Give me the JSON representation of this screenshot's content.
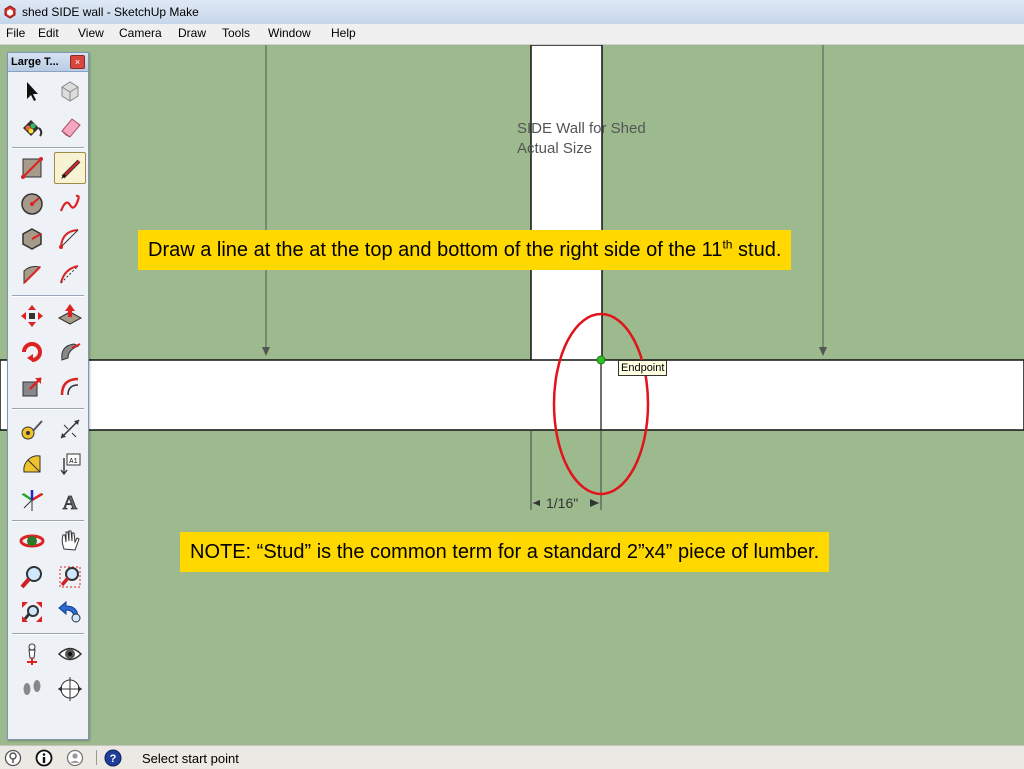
{
  "window": {
    "title": "shed SIDE wall - SketchUp Make"
  },
  "menu": {
    "items": [
      "File",
      "Edit",
      "View",
      "Camera",
      "Draw",
      "Tools",
      "Window",
      "Help"
    ]
  },
  "toolbar": {
    "title": "Large T...",
    "close_label": "×",
    "tools": [
      {
        "name": "select-tool-icon"
      },
      {
        "name": "make-component-tool-icon"
      },
      {
        "name": "paint-bucket-tool-icon"
      },
      {
        "name": "eraser-tool-icon"
      },
      {
        "name": "rectangle-tool-icon"
      },
      {
        "name": "line-tool-icon",
        "active": true
      },
      {
        "name": "circle-tool-icon"
      },
      {
        "name": "freehand-tool-icon"
      },
      {
        "name": "polygon-tool-icon"
      },
      {
        "name": "arc-tool-icon"
      },
      {
        "name": "pie-tool-icon"
      },
      {
        "name": "two-point-arc-tool-icon"
      },
      {
        "name": "move-tool-icon"
      },
      {
        "name": "push-pull-tool-icon"
      },
      {
        "name": "rotate-tool-icon"
      },
      {
        "name": "follow-me-tool-icon"
      },
      {
        "name": "scale-tool-icon"
      },
      {
        "name": "offset-tool-icon"
      },
      {
        "name": "tape-measure-tool-icon"
      },
      {
        "name": "dimension-tool-icon"
      },
      {
        "name": "protractor-tool-icon"
      },
      {
        "name": "text-tool-icon"
      },
      {
        "name": "axes-tool-icon"
      },
      {
        "name": "3d-text-tool-icon"
      },
      {
        "name": "orbit-tool-icon"
      },
      {
        "name": "pan-tool-icon"
      },
      {
        "name": "zoom-tool-icon"
      },
      {
        "name": "zoom-window-tool-icon"
      },
      {
        "name": "zoom-extents-tool-icon"
      },
      {
        "name": "previous-view-tool-icon"
      },
      {
        "name": "position-camera-tool-icon"
      },
      {
        "name": "look-around-tool-icon"
      },
      {
        "name": "walk-tool-icon"
      },
      {
        "name": "section-plane-tool-icon"
      }
    ]
  },
  "canvas": {
    "model_text_line1": "SIDE Wall for Shed",
    "model_text_line2": "Actual Size",
    "inference_tooltip": "Endpoint",
    "dimension_label": "1/16\""
  },
  "callouts": {
    "instruction_pre": "Draw a line at the at the top and bottom of the right side of the 11",
    "instruction_sup": "th",
    "instruction_post": " stud.",
    "note": "NOTE: “Stud” is the common term for a standard 2”x4” piece of lumber."
  },
  "status": {
    "text": "Select start point",
    "icons": [
      "geo-location-icon",
      "credits-icon",
      "user-icon",
      "help-icon"
    ]
  },
  "colors": {
    "canvas_green": "#9cba8e",
    "callout_yellow": "#ffd800",
    "highlight_ellipse": "#e0141a",
    "endpoint_dot": "#2fbf26"
  }
}
